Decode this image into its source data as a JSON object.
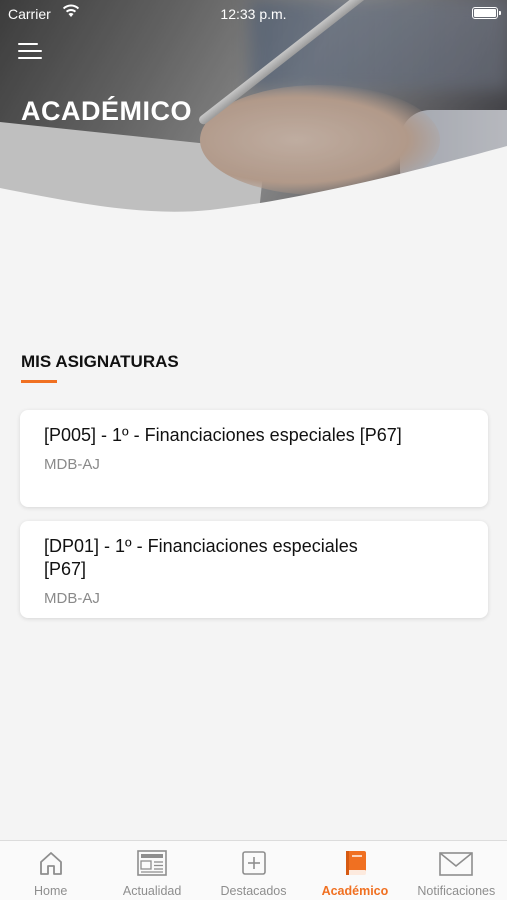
{
  "status_bar": {
    "carrier": "Carrier",
    "time": "12:33 p.m."
  },
  "header": {
    "title": "ACADÉMICO"
  },
  "section": {
    "title": "MIS ASIGNATURAS"
  },
  "courses": [
    {
      "title": "[P005] - 1º - Financiaciones especiales [P67]",
      "code": "MDB-AJ"
    },
    {
      "title": "[DP01] - 1º - Financiaciones especiales [P67]",
      "code": "MDB-AJ"
    }
  ],
  "tabs": [
    {
      "label": "Home",
      "icon": "home-icon"
    },
    {
      "label": "Actualidad",
      "icon": "news-icon"
    },
    {
      "label": "Destacados",
      "icon": "plus-box-icon"
    },
    {
      "label": "Académico",
      "icon": "book-icon",
      "active": true
    },
    {
      "label": "Notificaciones",
      "icon": "envelope-icon"
    }
  ],
  "colors": {
    "accent": "#f07021",
    "background": "#f4f4f4",
    "tab_inactive": "#8e8e8e"
  }
}
